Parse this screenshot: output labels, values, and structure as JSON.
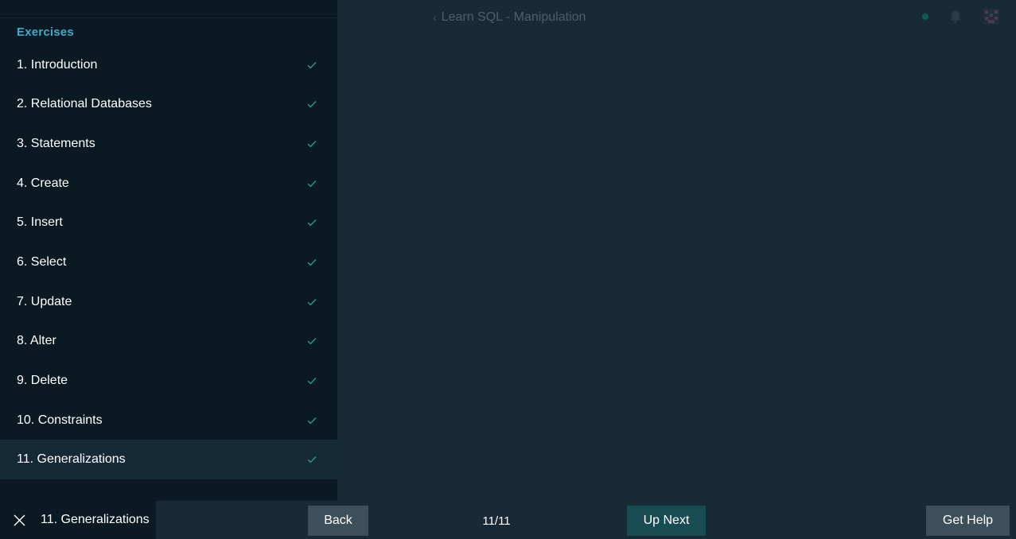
{
  "header": {
    "title": "Learn SQL - Manipulation",
    "back_icon": "chevron-left-icon"
  },
  "colors": {
    "accent": "#3fa9c9",
    "check": "#1fa58f",
    "sidebar_bg": "#0b1922",
    "main_bg": "#172a35",
    "up_next_bg": "#184b52"
  },
  "sidebar": {
    "heading": "Exercises",
    "items": [
      {
        "label": "1. Introduction",
        "completed": true
      },
      {
        "label": "2. Relational Databases",
        "completed": true
      },
      {
        "label": "3. Statements",
        "completed": true
      },
      {
        "label": "4. Create",
        "completed": true
      },
      {
        "label": "5. Insert",
        "completed": true
      },
      {
        "label": "6. Select",
        "completed": true
      },
      {
        "label": "7. Update",
        "completed": true
      },
      {
        "label": "8. Alter",
        "completed": true
      },
      {
        "label": "9. Delete",
        "completed": true
      },
      {
        "label": "10. Constraints",
        "completed": true
      },
      {
        "label": "11. Generalizations",
        "completed": true,
        "active": true
      }
    ]
  },
  "bottom_bar": {
    "current_exercise": "11. Generalizations",
    "back_label": "Back",
    "progress": "11/11",
    "up_next_label": "Up Next",
    "get_help_label": "Get Help"
  }
}
